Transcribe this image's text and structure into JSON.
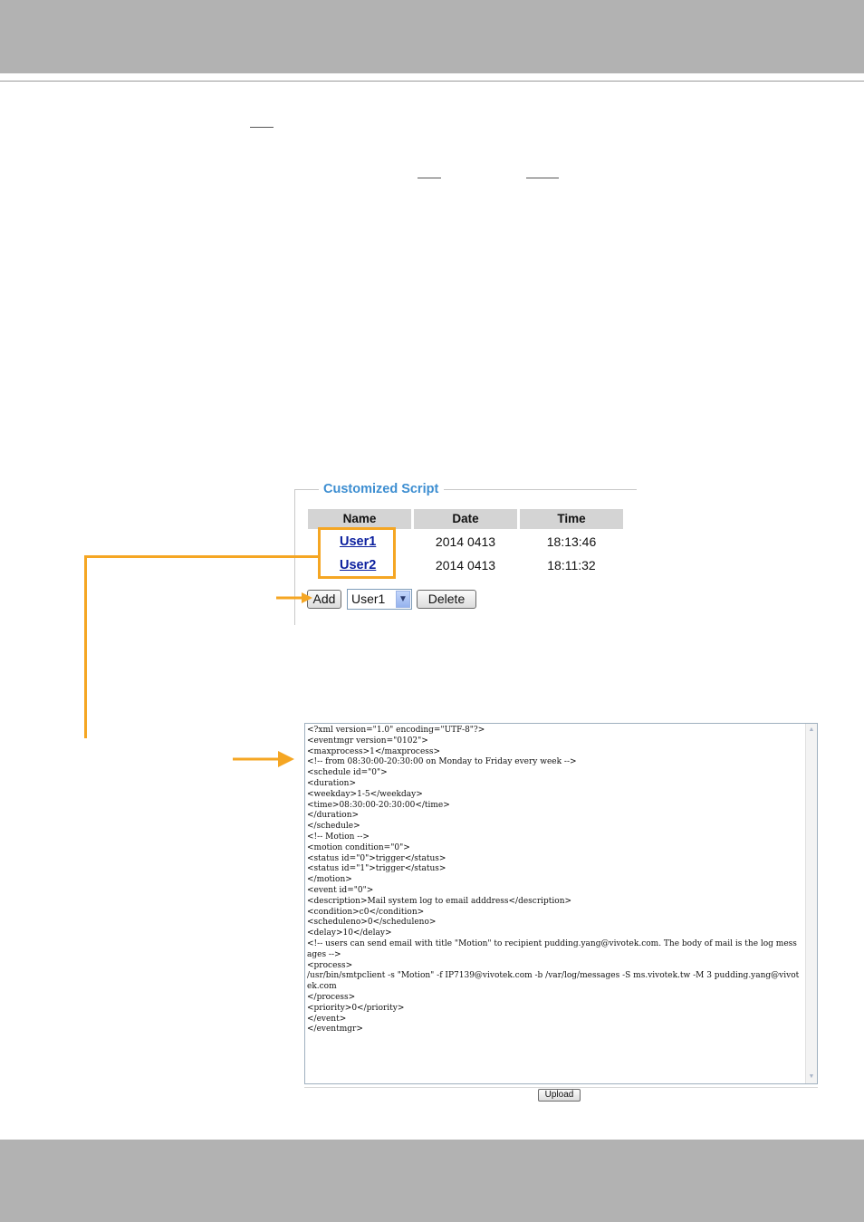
{
  "script_panel": {
    "title": "Customized Script",
    "columns": [
      "Name",
      "Date",
      "Time"
    ],
    "rows": [
      {
        "name": "User1",
        "date": "2014 0413",
        "time": "18:13:46"
      },
      {
        "name": "User2",
        "date": "2014 0413",
        "time": "18:11:32"
      }
    ],
    "add_label": "Add",
    "selected_user": "User1",
    "delete_label": "Delete"
  },
  "script_editor": {
    "content": "<?xml version=\"1.0\" encoding=\"UTF-8\"?>\n<eventmgr version=\"0102\">\n<maxprocess>1</maxprocess>\n<!-- from 08:30:00-20:30:00 on Monday to Friday every week -->\n<schedule id=\"0\">\n<duration>\n<weekday>1-5</weekday>\n<time>08:30:00-20:30:00</time>\n</duration>\n</schedule>\n<!-- Motion -->\n<motion condition=\"0\">\n<status id=\"0\">trigger</status>\n<status id=\"1\">trigger</status>\n</motion>\n<event id=\"0\">\n<description>Mail system log to email adddress</description>\n<condition>c0</condition>\n<scheduleno>0</scheduleno>\n<delay>10</delay>\n<!-- users can send email with title \"Motion\" to recipient pudding.yang@vivotek.com. The body of mail is the log messages -->\n<process>\n/usr/bin/smtpclient -s \"Motion\" -f IP7139@vivotek.com -b /var/log/messages -S ms.vivotek.tw -M 3 pudding.yang@vivotek.com\n</process>\n<priority>0</priority>\n</event>\n</eventmgr>",
    "upload_label": "Upload"
  },
  "colors": {
    "header_bar": "#b2b2b2",
    "legend": "#3d8ed1",
    "link": "#0b1f9e",
    "annotation": "#f5a623"
  },
  "icons": [
    "chevron-down-icon",
    "arrow-right-icon",
    "scroll-up-icon",
    "scroll-down-icon"
  ]
}
